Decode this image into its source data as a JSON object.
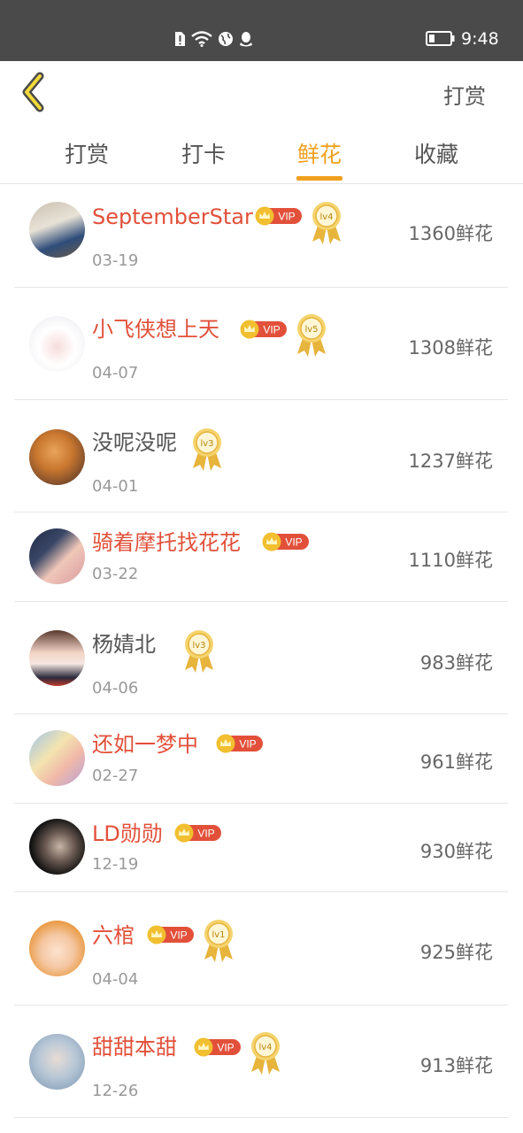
{
  "status_bar": {
    "time": "9:48"
  },
  "header": {
    "action_label": "打赏"
  },
  "tabs": [
    {
      "label": "打赏"
    },
    {
      "label": "打卡"
    },
    {
      "label": "鲜花",
      "active": true
    },
    {
      "label": "收藏"
    }
  ],
  "vip_label": "VIP",
  "colors": {
    "accent": "#f0a01e",
    "vip_name": "#e2503a",
    "badge_red": "#e2503a",
    "gold": "#e7b43c"
  },
  "rows": [
    {
      "name": "SeptemberStar",
      "vip": true,
      "level": "lv4",
      "date": "03-19",
      "amount": "1360鲜花"
    },
    {
      "name": "小飞侠想上天",
      "vip": true,
      "level": "lv5",
      "date": "04-07",
      "amount": "1308鲜花"
    },
    {
      "name": "没呢没呢",
      "vip": false,
      "level": "lv3",
      "date": "04-01",
      "amount": "1237鲜花"
    },
    {
      "name": "骑着摩托找花花",
      "vip": true,
      "level": null,
      "date": "03-22",
      "amount": "1110鲜花"
    },
    {
      "name": "杨婧北",
      "vip": false,
      "level": "lv3",
      "date": "04-06",
      "amount": "983鲜花"
    },
    {
      "name": "还如一梦中",
      "vip": true,
      "level": null,
      "date": "02-27",
      "amount": "961鲜花"
    },
    {
      "name": "LD勋勋",
      "vip": true,
      "level": null,
      "date": "12-19",
      "amount": "930鲜花"
    },
    {
      "name": "六棺",
      "vip": true,
      "level": "lv1",
      "date": "04-04",
      "amount": "925鲜花"
    },
    {
      "name": "甜甜本甜",
      "vip": true,
      "level": "lv4",
      "date": "12-26",
      "amount": "913鲜花"
    }
  ]
}
